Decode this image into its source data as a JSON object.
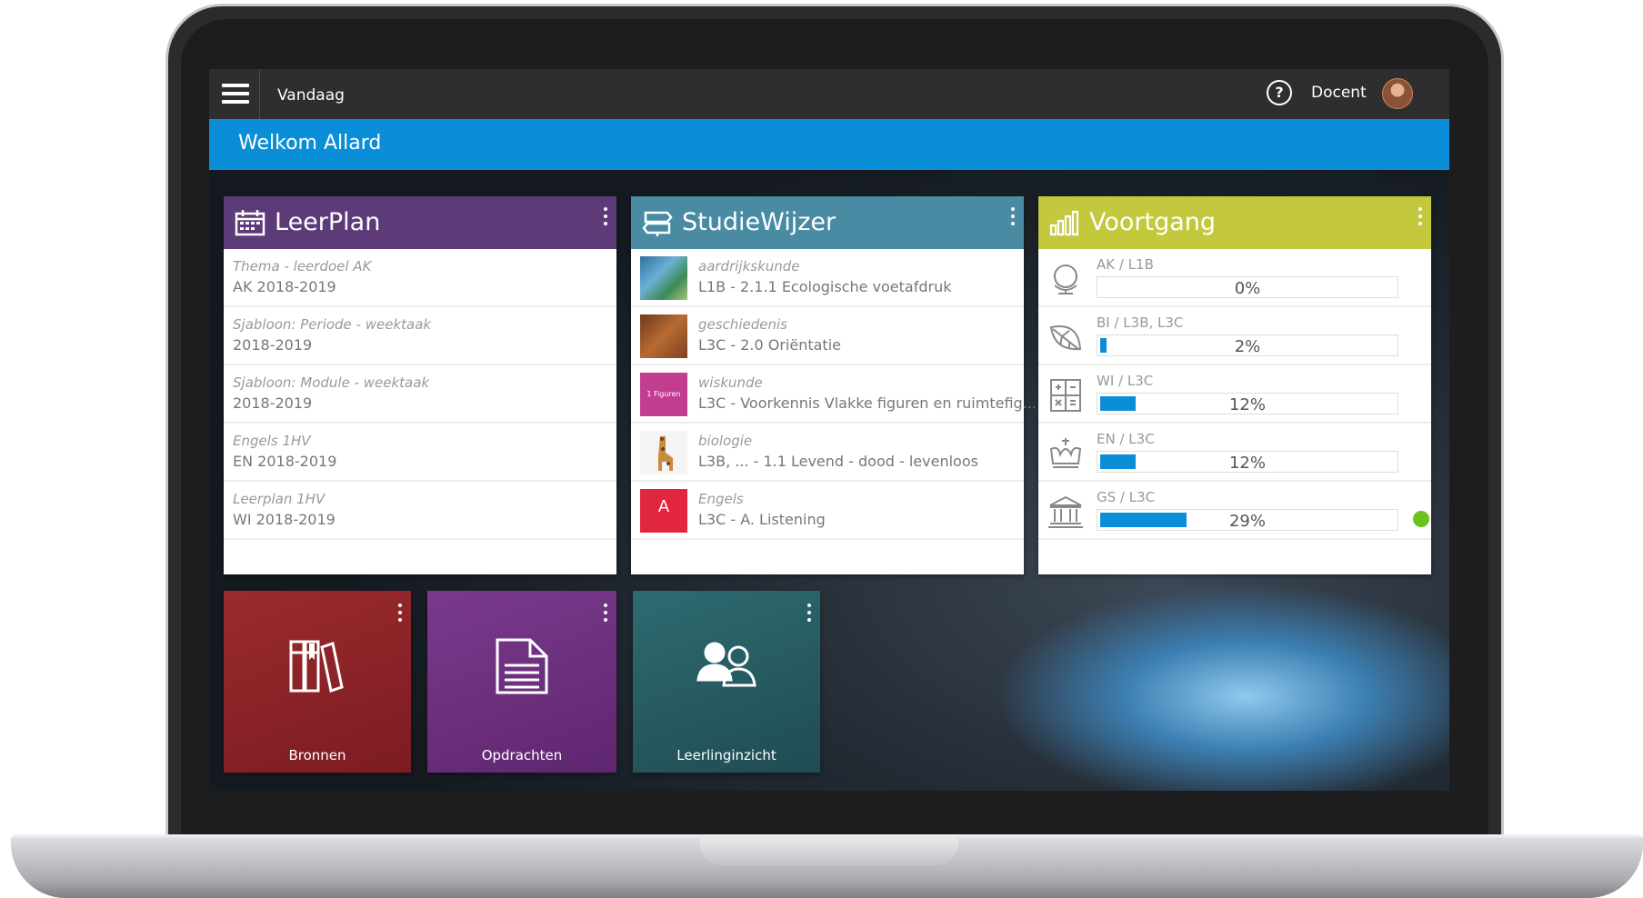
{
  "topbar": {
    "page": "Vandaag",
    "help_icon": "?",
    "role": "Docent"
  },
  "welcome": "Welkom Allard",
  "leerplan": {
    "title": "LeerPlan",
    "color": "#5d3b78",
    "items": [
      {
        "subject": "Thema - leerdoel AK",
        "period": "AK 2018-2019"
      },
      {
        "subject": "Sjabloon: Periode - weektaak",
        "period": "2018-2019"
      },
      {
        "subject": "Sjabloon: Module - weektaak",
        "period": "2018-2019"
      },
      {
        "subject": "Engels 1HV",
        "period": "EN 2018-2019"
      },
      {
        "subject": "Leerplan 1HV",
        "period": "WI 2018-2019"
      }
    ]
  },
  "studiewijzer": {
    "title": "StudieWijzer",
    "color": "#4a8ba4",
    "items": [
      {
        "subject": "aardrijkskunde",
        "detail": "L1B - 2.1.1 Ecologische voetafdruk",
        "thumb": "earth"
      },
      {
        "subject": "geschiedenis",
        "detail": "L3C - 2.0 Oriëntatie",
        "thumb": "history"
      },
      {
        "subject": "wiskunde",
        "detail": "L3C - Voorkennis Vlakke figuren en ruimtefig...",
        "thumb": "math",
        "thumb_text": "1 Figuren"
      },
      {
        "subject": "biologie",
        "detail": "L3B, ... - 1.1 Levend - dood - levenloos",
        "thumb": "giraffe"
      },
      {
        "subject": "Engels",
        "detail": "L3C - A. Listening",
        "thumb": "english",
        "thumb_text": "A"
      }
    ]
  },
  "voortgang": {
    "title": "Voortgang",
    "color": "#c4c83c",
    "items": [
      {
        "label": "AK / L1B",
        "percent": 0,
        "text": "0%",
        "icon": "globe-icon"
      },
      {
        "label": "BI / L3B, L3C",
        "percent": 2,
        "text": "2%",
        "icon": "leaf-icon"
      },
      {
        "label": "WI / L3C",
        "percent": 12,
        "text": "12%",
        "icon": "calculator-icon"
      },
      {
        "label": "EN / L3C",
        "percent": 12,
        "text": "12%",
        "icon": "crown-icon"
      },
      {
        "label": "GS / L3C",
        "percent": 29,
        "text": "29%",
        "icon": "museum-icon",
        "status": "green"
      }
    ]
  },
  "tiles": [
    {
      "label": "Bronnen",
      "color": "#8b2126",
      "icon": "books-icon"
    },
    {
      "label": "Opdrachten",
      "color": "#6a2f7b",
      "icon": "document-icon"
    },
    {
      "label": "Leerlinginzicht",
      "color": "#245a61",
      "icon": "students-icon"
    }
  ]
}
